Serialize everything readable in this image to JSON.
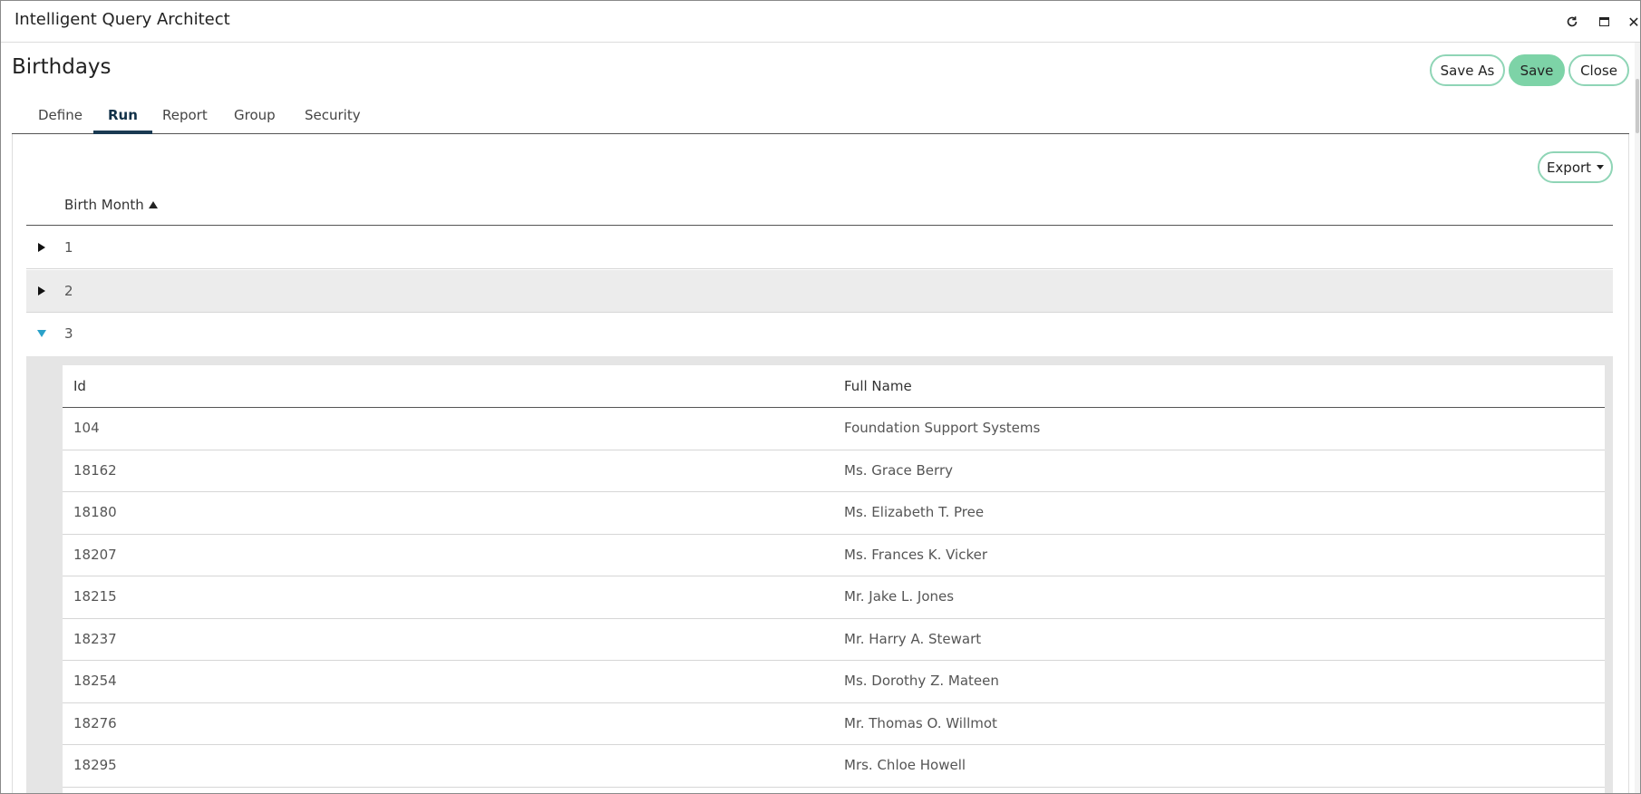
{
  "window": {
    "title": "Intelligent Query Architect"
  },
  "page": {
    "title": "Birthdays"
  },
  "actions": {
    "save_as": "Save As",
    "save": "Save",
    "close": "Close"
  },
  "tabs": [
    {
      "label": "Define",
      "active": false
    },
    {
      "label": "Run",
      "active": true
    },
    {
      "label": "Report",
      "active": false
    },
    {
      "label": "Group",
      "active": false
    },
    {
      "label": "Security",
      "active": false
    }
  ],
  "export": {
    "label": "Export"
  },
  "grid": {
    "group_column": "Birth Month",
    "sort": "ascending",
    "groups": [
      {
        "value": "1",
        "expanded": false
      },
      {
        "value": "2",
        "expanded": false
      },
      {
        "value": "3",
        "expanded": true
      }
    ]
  },
  "detail": {
    "columns": [
      "Id",
      "Full Name"
    ],
    "rows": [
      {
        "id": "104",
        "name": "Foundation Support Systems"
      },
      {
        "id": "18162",
        "name": "Ms. Grace Berry"
      },
      {
        "id": "18180",
        "name": "Ms. Elizabeth T. Pree"
      },
      {
        "id": "18207",
        "name": "Ms. Frances K. Vicker"
      },
      {
        "id": "18215",
        "name": "Mr. Jake L. Jones"
      },
      {
        "id": "18237",
        "name": "Mr. Harry A. Stewart"
      },
      {
        "id": "18254",
        "name": "Ms. Dorothy Z. Mateen"
      },
      {
        "id": "18276",
        "name": "Mr. Thomas O. Willmot"
      },
      {
        "id": "18295",
        "name": "Mrs. Chloe Howell"
      }
    ]
  },
  "icons": {
    "refresh": "refresh-icon",
    "maximize": "maximize-icon",
    "close": "close-icon"
  },
  "colors": {
    "accent_green": "#7dd3a7",
    "outline_green": "#8fd5b6",
    "active_tab": "#1a3a52",
    "expand_blue": "#2aa1c9"
  }
}
